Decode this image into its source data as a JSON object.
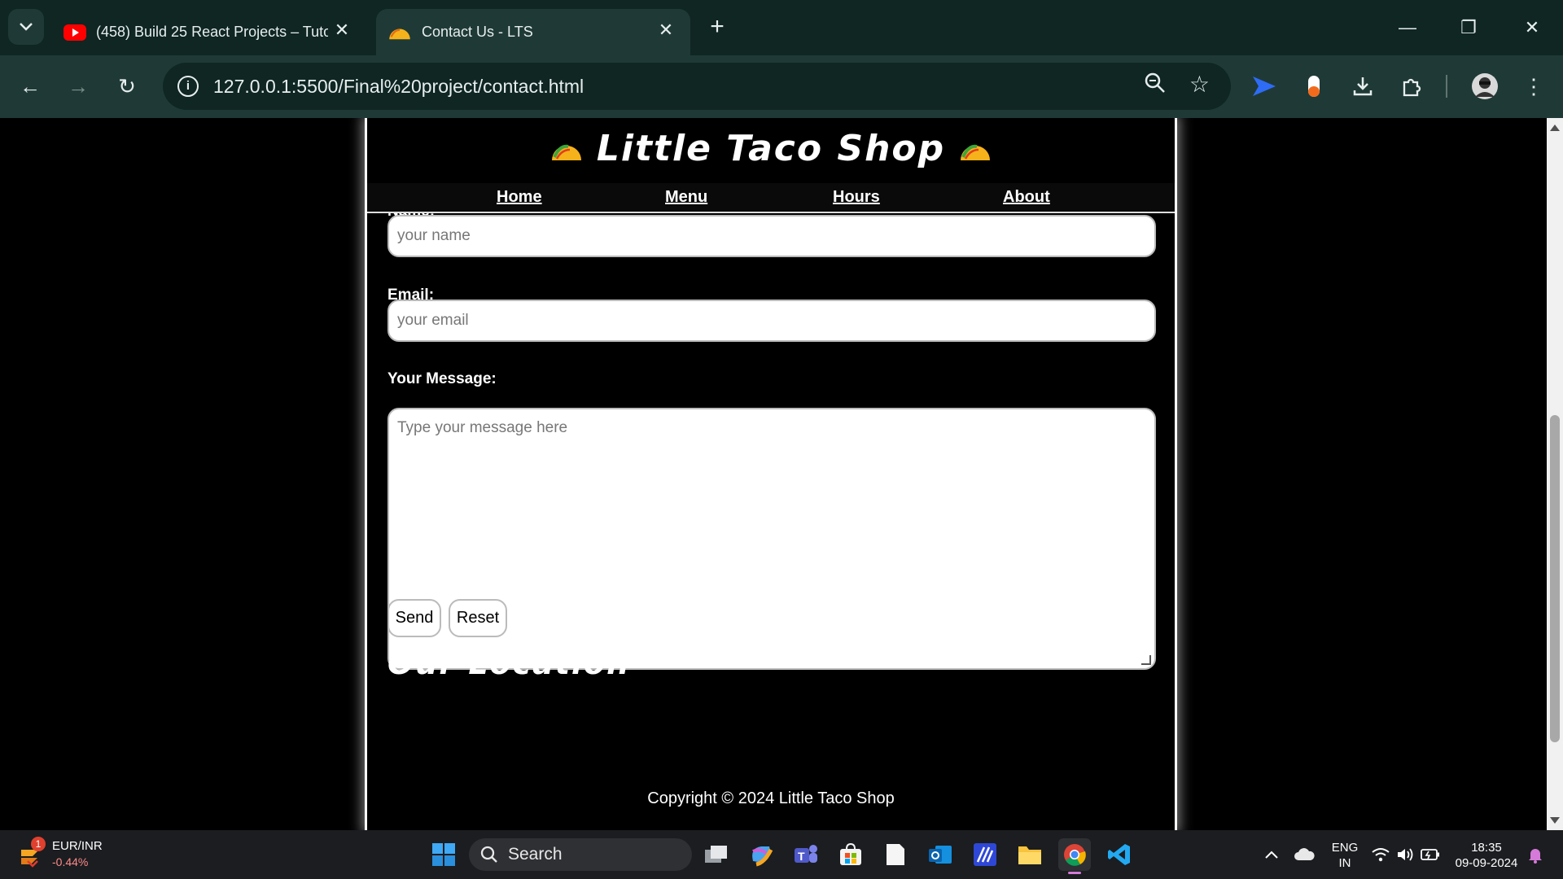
{
  "browser": {
    "tabs": [
      {
        "title": "(458) Build 25 React Projects – Tuto",
        "active": false
      },
      {
        "title": "Contact Us - LTS",
        "active": true
      }
    ],
    "url": "127.0.0.1:5500/Final%20project/contact.html"
  },
  "site": {
    "brand": "Little Taco Shop",
    "nav": [
      "Home",
      "Menu",
      "Hours",
      "About"
    ]
  },
  "form": {
    "name_label": "Name:",
    "name_placeholder": "your name",
    "email_label": "Email:",
    "email_placeholder": "your email",
    "message_label": "Your Message:",
    "message_placeholder": "Type your message here",
    "send_label": "Send",
    "reset_label": "Reset"
  },
  "location_heading": "Our Location",
  "footer": "Copyright © 2024 Little Taco Shop",
  "taskbar": {
    "widget_pair": "EUR/INR",
    "widget_change": "-0.44%",
    "widget_badge": "1",
    "search": "Search",
    "lang_top": "ENG",
    "lang_bottom": "IN",
    "time": "18:35",
    "date": "09-09-2024"
  }
}
